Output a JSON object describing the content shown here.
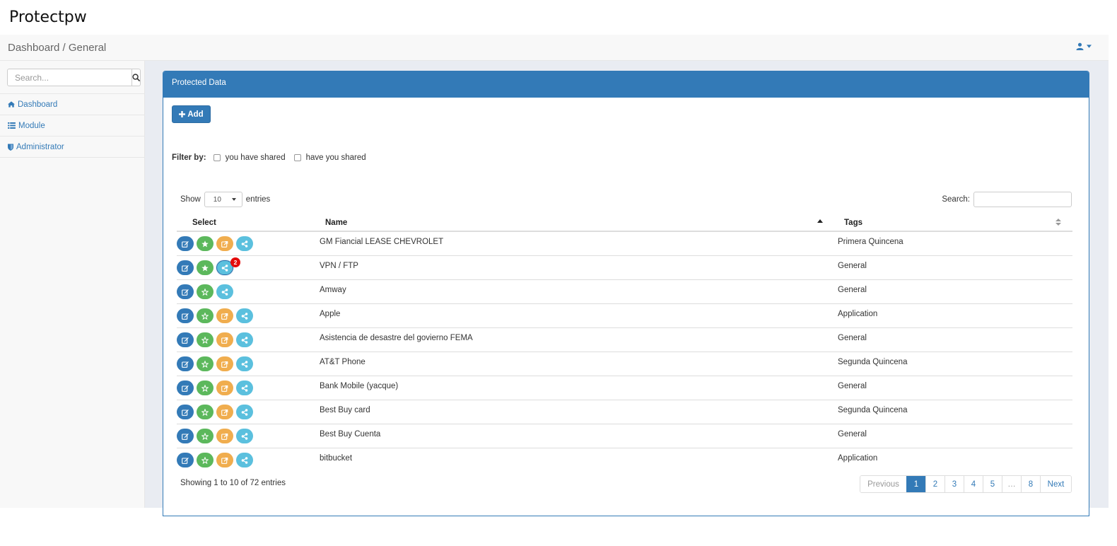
{
  "app": {
    "title": "Protectpw"
  },
  "header": {
    "breadcrumb": "Dashboard / General"
  },
  "sidebar": {
    "search_placeholder": "Search...",
    "items": [
      {
        "label": "Dashboard",
        "icon": "home-icon"
      },
      {
        "label": "Module",
        "icon": "list-icon"
      },
      {
        "label": "Administrator",
        "icon": "shield-icon"
      }
    ]
  },
  "panel": {
    "title": "Protected Data",
    "add_label": "Add",
    "filter": {
      "label": "Filter by:",
      "option1": "you have shared",
      "option2": "have you shared"
    },
    "length": {
      "show": "Show",
      "value": "10",
      "entries": "entries"
    },
    "search_label": "Search:",
    "columns": {
      "select": "Select",
      "name": "Name",
      "tags": "Tags"
    },
    "rows": [
      {
        "name": "GM Fiancial LEASE CHEVROLET",
        "tags": "Primera Quincena"
      },
      {
        "name": "VPN / FTP",
        "tags": "General"
      },
      {
        "name": "Amway",
        "tags": "General"
      },
      {
        "name": "Apple",
        "tags": "Application"
      },
      {
        "name": "Asistencia de desastre del govierno FEMA",
        "tags": "General"
      },
      {
        "name": "AT&T Phone",
        "tags": "Segunda Quincena"
      },
      {
        "name": "Bank Mobile (yacque)",
        "tags": "General"
      },
      {
        "name": "Best Buy card",
        "tags": "Segunda Quincena"
      },
      {
        "name": "Best Buy Cuenta",
        "tags": "General"
      },
      {
        "name": "bitbucket",
        "tags": "Application"
      }
    ],
    "share_badge": "2",
    "info": "Showing 1 to 10 of 72 entries",
    "pagination": {
      "previous": "Previous",
      "next": "Next",
      "pages": [
        "1",
        "2",
        "3",
        "4",
        "5",
        "…",
        "8"
      ]
    }
  },
  "colors": {
    "primary": "#337ab7",
    "success": "#5cb85c",
    "warning": "#f0ad4e",
    "info": "#5bc0de",
    "badge": "#e40b0b"
  }
}
